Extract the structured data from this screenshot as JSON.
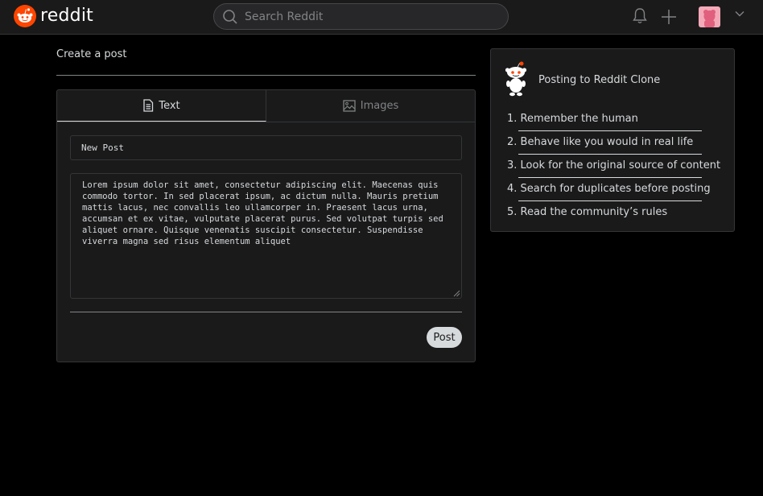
{
  "header": {
    "logo_text": "reddit",
    "search_placeholder": "Search Reddit",
    "brand_color": "#ff4500"
  },
  "create": {
    "title": "Create a post",
    "tabs": [
      {
        "label": "Text",
        "icon": "document-icon",
        "active": true
      },
      {
        "label": "Images",
        "icon": "image-icon",
        "active": false
      }
    ],
    "title_value": "New Post",
    "body_value": "Lorem ipsum dolor sit amet, consectetur adipiscing elit. Maecenas quis commodo tortor. In sed placerat ipsum, ac dictum nulla. Mauris pretium mattis lacus, nec convallis leo ullamcorper in. Praesent lacus urna, accumsan et ex vitae, vulputate placerat purus. Sed volutpat turpis sed aliquet ornare. Quisque venenatis suscipit consectetur. Suspendisse viverra magna sed risus elementum aliquet",
    "post_label": "Post"
  },
  "sidebar": {
    "title": "Posting to Reddit Clone",
    "rules": [
      {
        "num": "1.",
        "text": "Remember the human"
      },
      {
        "num": "2.",
        "text": "Behave like you would in real life"
      },
      {
        "num": "3.",
        "text": "Look for the original source of content"
      },
      {
        "num": "4.",
        "text": "Search for duplicates before posting"
      },
      {
        "num": "5.",
        "text": "Read the community’s rules"
      }
    ]
  }
}
